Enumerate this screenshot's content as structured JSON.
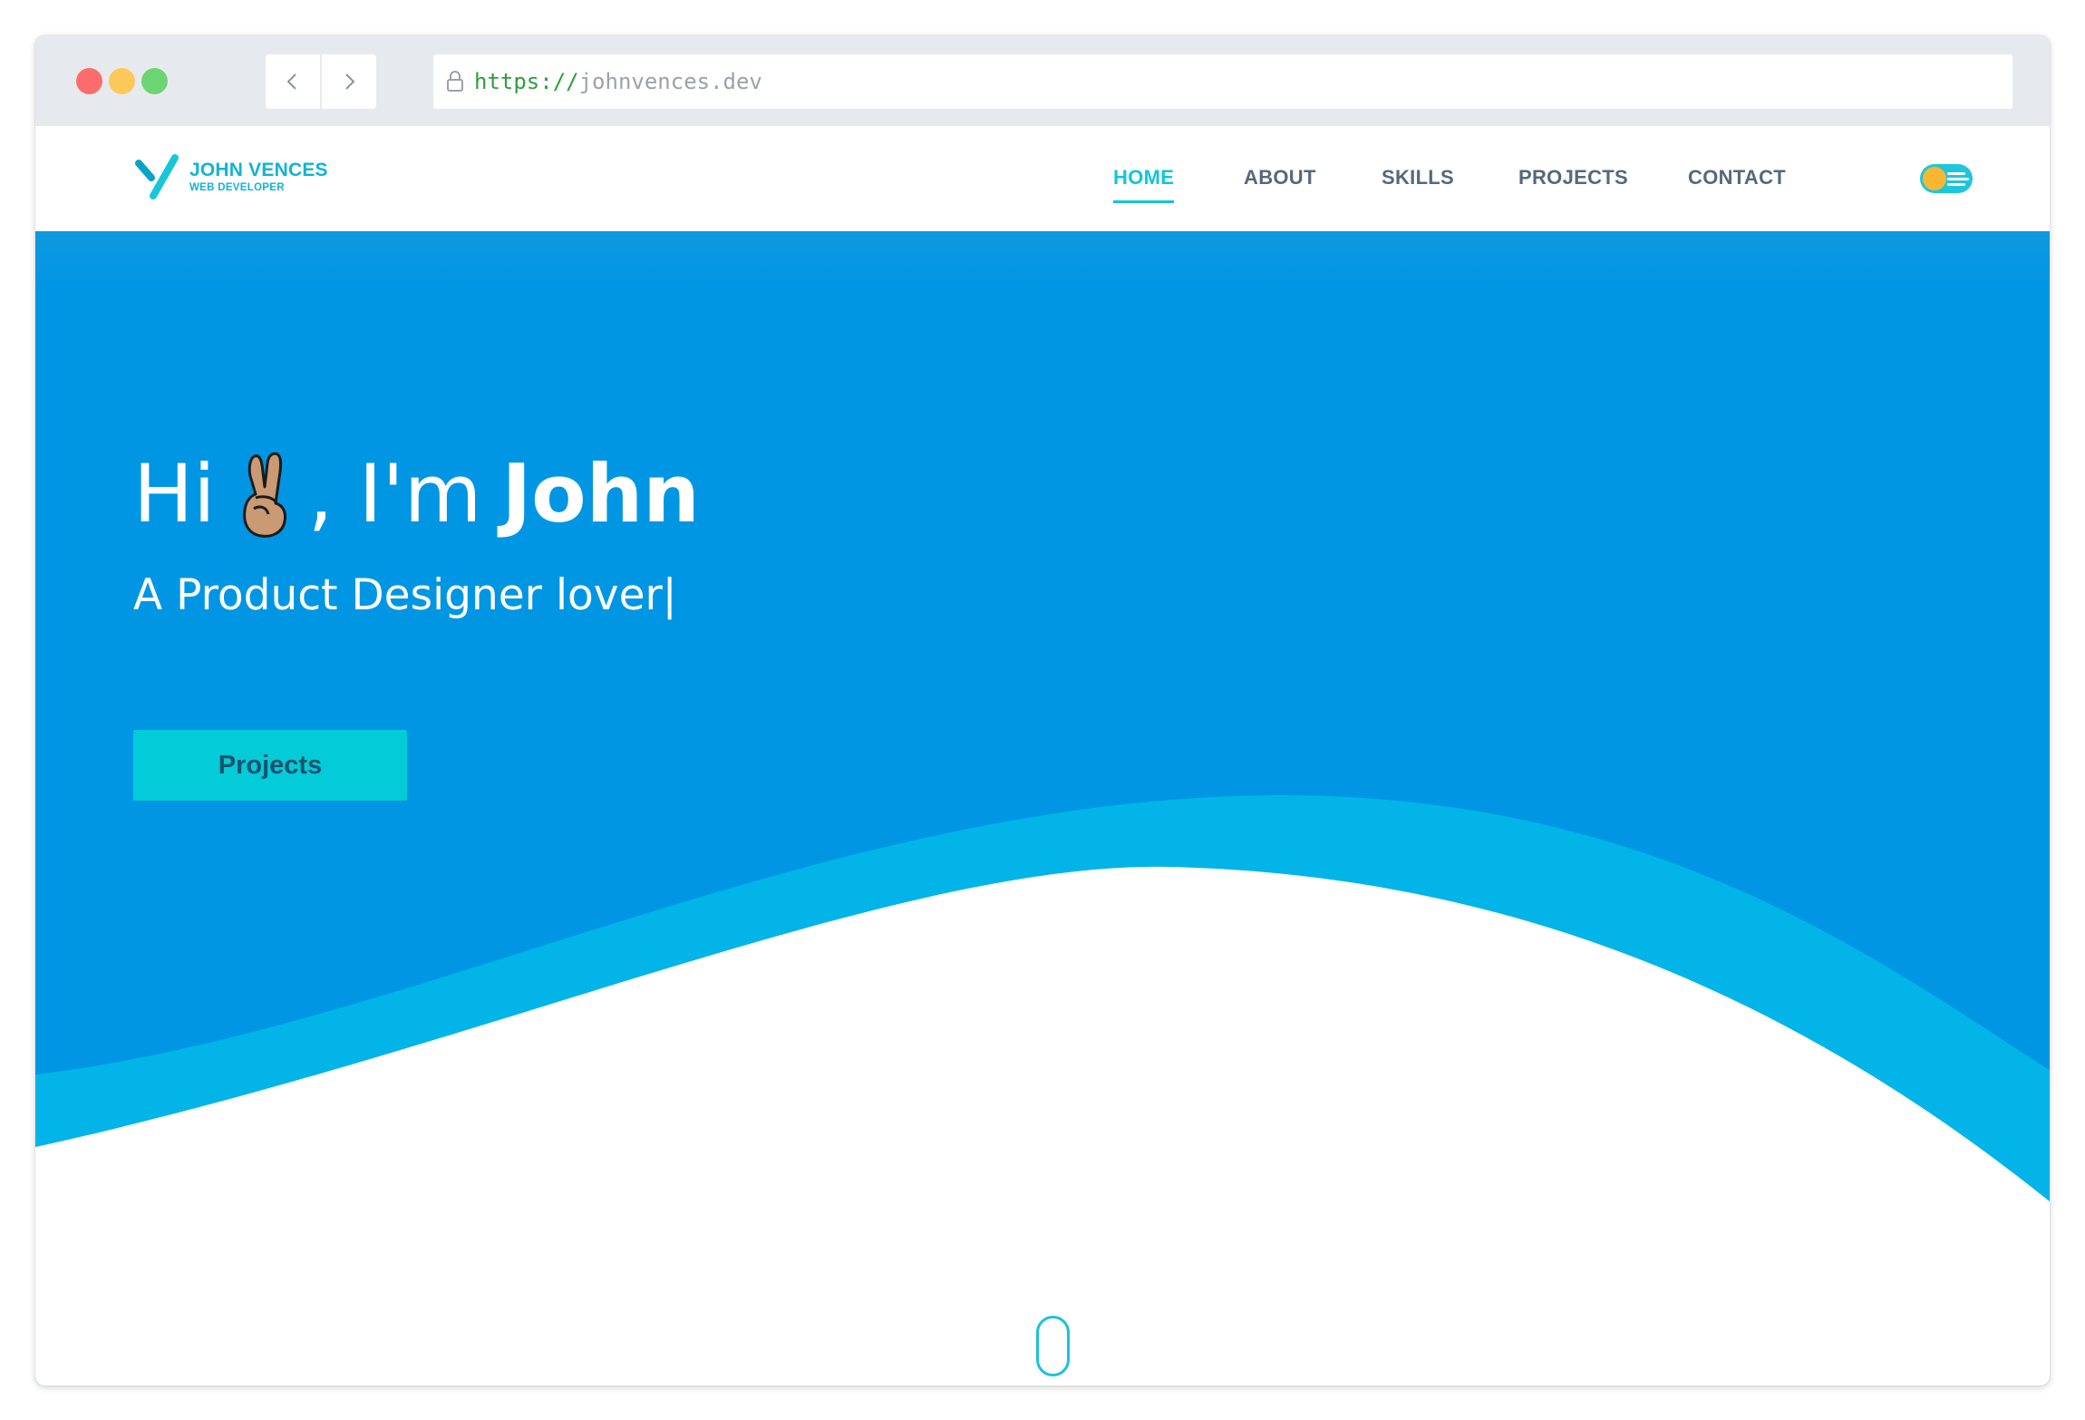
{
  "browser": {
    "address": {
      "scheme": "https://",
      "host": "johnvences.dev"
    },
    "icons": {
      "back": "chevron-left-icon",
      "forward": "chevron-right-icon",
      "lock": "lock-icon"
    }
  },
  "site": {
    "logo": {
      "name": "JOHN VENCES",
      "role": "WEB DEVELOPER"
    },
    "nav": {
      "home": "HOME",
      "about": "ABOUT",
      "skills": "SKILLS",
      "projects": "PROJECTS",
      "contact": "CONTACT",
      "active": "HOME"
    },
    "theme_toggle": {
      "icon": "theme-toggle-icon"
    }
  },
  "hero": {
    "greeting_prefix": "Hi",
    "greeting_middle": ", I'm",
    "name": "John",
    "emoji": "victory-hand",
    "subtitle": "A Product Designer lover|",
    "button_label": "Projects",
    "scroll_icon": "mouse-scroll-icon"
  },
  "colors": {
    "hero_blue": "#0096e3",
    "wave_light": "#02b4e8",
    "accent": "#11c5dc",
    "button_bg": "#03cbd8",
    "nav_text": "#55697c",
    "toggle_knob": "#f7b733"
  }
}
